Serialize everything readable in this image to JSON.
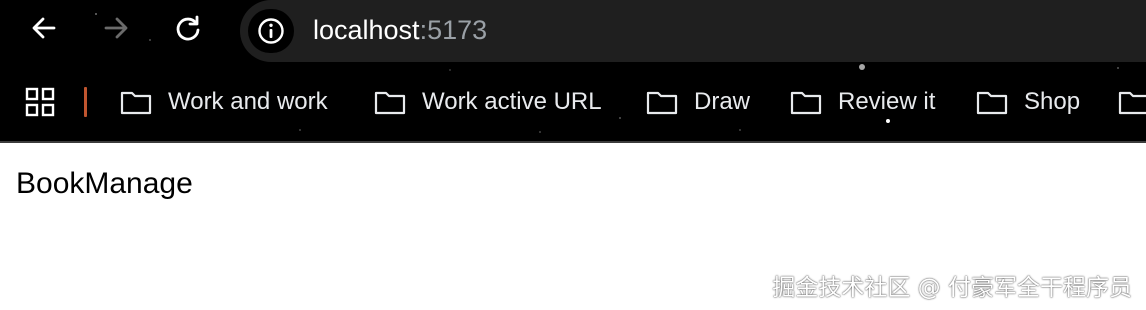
{
  "address_bar": {
    "host": "localhost",
    "port": ":5173"
  },
  "bookmarks": {
    "items": [
      {
        "label": "Work and work"
      },
      {
        "label": "Work active URL"
      },
      {
        "label": "Draw"
      },
      {
        "label": "Review it"
      },
      {
        "label": "Shop"
      }
    ]
  },
  "page": {
    "heading": "BookManage"
  },
  "watermark": {
    "text": "掘金技术社区 @ 付豪军全干程序员"
  },
  "icons": {
    "back": "arrow-left-icon",
    "forward": "arrow-right-icon",
    "reload": "reload-icon",
    "site_info": "info-icon",
    "apps": "apps-grid-icon",
    "folder": "folder-icon"
  },
  "colors": {
    "toolbar_bg": "#000000",
    "omnibox_bg": "#1f1f1f",
    "separator": "#c0552f",
    "text_light": "#e8eaed",
    "port_gray": "#9aa0a6"
  }
}
